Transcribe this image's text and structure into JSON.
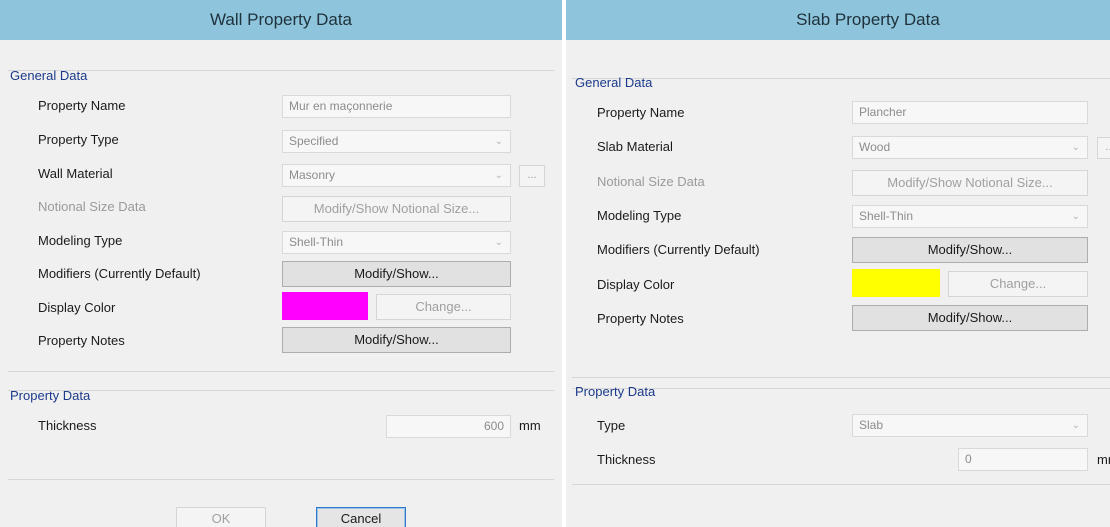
{
  "wall": {
    "title": "Wall Property Data",
    "general_title": "General Data",
    "labels": {
      "property_name": "Property Name",
      "property_type": "Property Type",
      "wall_material": "Wall Material",
      "notional_size_data": "Notional Size Data",
      "modeling_type": "Modeling Type",
      "modifiers": "Modifiers (Currently Default)",
      "display_color": "Display Color",
      "property_notes": "Property Notes",
      "thickness": "Thickness"
    },
    "values": {
      "property_name": "Mur en maçonnerie",
      "property_type": "Specified",
      "wall_material": "Masonry",
      "modeling_type": "Shell-Thin",
      "thickness": "600"
    },
    "buttons": {
      "material_more": "...",
      "notional_size": "Modify/Show Notional Size...",
      "modifiers": "Modify/Show...",
      "change_color": "Change...",
      "notes": "Modify/Show...",
      "ok": "OK",
      "cancel": "Cancel"
    },
    "display_color": "#ff00ff",
    "property_data_title": "Property Data",
    "unit": "mm"
  },
  "slab": {
    "title": "Slab Property Data",
    "general_title": "General Data",
    "labels": {
      "property_name": "Property Name",
      "slab_material": "Slab Material",
      "notional_size_data": "Notional Size Data",
      "modeling_type": "Modeling Type",
      "modifiers": "Modifiers (Currently Default)",
      "display_color": "Display Color",
      "property_notes": "Property Notes",
      "type": "Type",
      "thickness": "Thickness"
    },
    "values": {
      "property_name": "Plancher",
      "slab_material": "Wood",
      "modeling_type": "Shell-Thin",
      "type": "Slab",
      "thickness": "0"
    },
    "buttons": {
      "material_more": "...",
      "notional_size": "Modify/Show Notional Size...",
      "modifiers": "Modify/Show...",
      "change_color": "Change...",
      "notes": "Modify/Show..."
    },
    "display_color": "#ffff00",
    "property_data_title": "Property Data",
    "unit": "mm"
  },
  "icons": {
    "dropdown": "chevron-down-icon"
  },
  "colors": {
    "titlebar": "#8ec5dd",
    "group_title": "#1b3a8a"
  }
}
